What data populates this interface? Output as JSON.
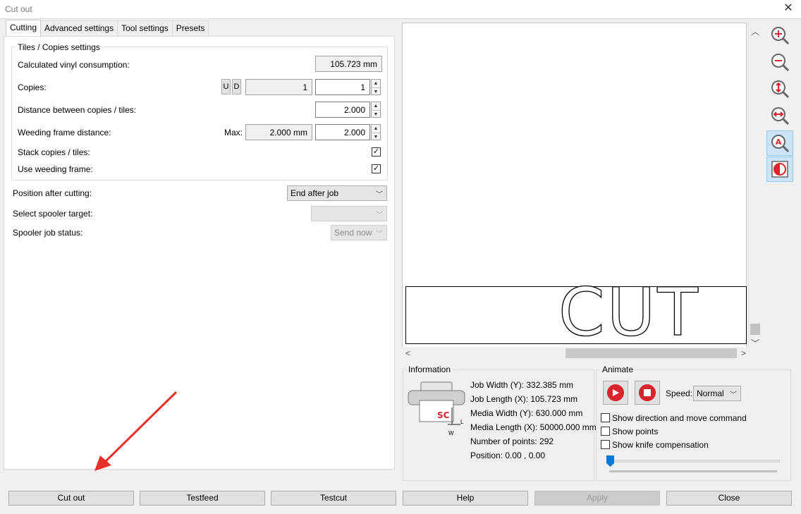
{
  "window": {
    "title": "Cut out"
  },
  "tabs": [
    {
      "label": "Cutting",
      "active": true
    },
    {
      "label": "Advanced settings",
      "active": false
    },
    {
      "label": "Tool settings",
      "active": false
    },
    {
      "label": "Presets",
      "active": false
    }
  ],
  "tiles": {
    "group_label": "Tiles / Copies settings",
    "vinyl_label": "Calculated vinyl consumption:",
    "vinyl_value": "105.723 mm",
    "copies_label": "Copies:",
    "copies_u": "U",
    "copies_d": "D",
    "copies_readonly": "1",
    "copies_value": "1",
    "distance_label": "Distance between copies / tiles:",
    "distance_value": "2.000",
    "weeding_label": "Weeding frame distance:",
    "weeding_max_label": "Max:",
    "weeding_max_value": "2.000 mm",
    "weeding_value": "2.000",
    "stack_label": "Stack copies / tiles:",
    "stack_checked": true,
    "use_weeding_label": "Use weeding frame:",
    "use_weeding_checked": true
  },
  "position": {
    "label": "Position after cutting:",
    "value": "End after job"
  },
  "spooler": {
    "target_label": "Select spooler target:",
    "target_value": "",
    "status_label": "Spooler job status:",
    "status_value": "Send now"
  },
  "preview": {
    "text": "CUT"
  },
  "zoom_tools": [
    "zoom-in-icon",
    "zoom-out-icon",
    "zoom-fit-height-icon",
    "zoom-fit-width-icon",
    "auto-zoom-icon",
    "contrast-icon"
  ],
  "information": {
    "label": "Information",
    "job_width": "Job Width (Y): 332.385 mm",
    "job_length": "Job Length (X): 105.723 mm",
    "media_width": "Media Width (Y): 630.000 mm",
    "media_length": "Media Length (X): 50000.000 mm",
    "points": "Number of points: 292",
    "position": "Position: 0.00 , 0.00",
    "logo_text": "SC",
    "logo_l": "L",
    "logo_w": "W"
  },
  "animate": {
    "label": "Animate",
    "speed_label": "Speed:",
    "speed_value": "Normal",
    "opt_direction": "Show direction and move command",
    "opt_points": "Show points",
    "opt_knife": "Show knife compensation"
  },
  "buttons": {
    "cut_out": "Cut out",
    "testfeed": "Testfeed",
    "testcut": "Testcut",
    "help": "Help",
    "apply": "Apply",
    "close": "Close"
  },
  "colors": {
    "accent_red": "#d9232d",
    "arrow_red": "#e8302a",
    "selected_tool": "#cce4f7"
  }
}
